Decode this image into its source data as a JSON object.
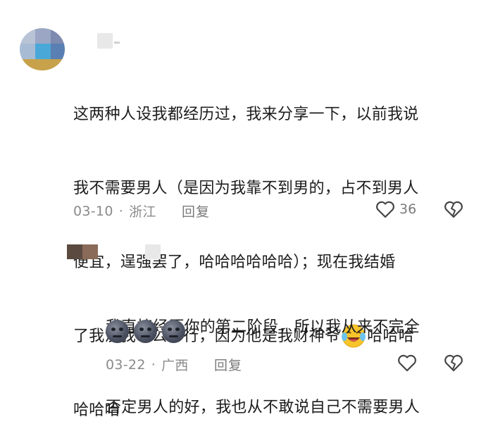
{
  "comments": [
    {
      "text_lines": [
        "这两种人设我都经历过，我来分享一下，以前我说",
        "我不需要男人（是因为我靠不到男的，占不到男人",
        "便宜，逞强罢了，哈哈哈哈哈哈）；现在我结婚",
        "了我没我老公不行，因为他是我财神爷",
        "哈哈哈"
      ],
      "inline_after_line4": "哈哈哈",
      "date": "03-10",
      "location": "浙江",
      "reply_label": "回复",
      "like_count": "36"
    },
    {
      "text_lines": [
        "我直接经历你的第二阶段，所以我从来不完全",
        "否定男人的好，我也从不敢说自己不需要男人"
      ],
      "date": "03-22",
      "location": "广西",
      "reply_label": "回复"
    }
  ],
  "separator_dot": "·",
  "icons": {
    "like": "heart-outline-icon",
    "dislike": "broken-heart-outline-icon",
    "laugh_cry_emoji": "laughing-crying-emoji-icon",
    "moon_emoji": "new-moon-face-emoji-icon"
  },
  "colors": {
    "text": "#1c1c1c",
    "meta": "#8a8a8a",
    "emoji_yellow": "#f7c52b"
  }
}
